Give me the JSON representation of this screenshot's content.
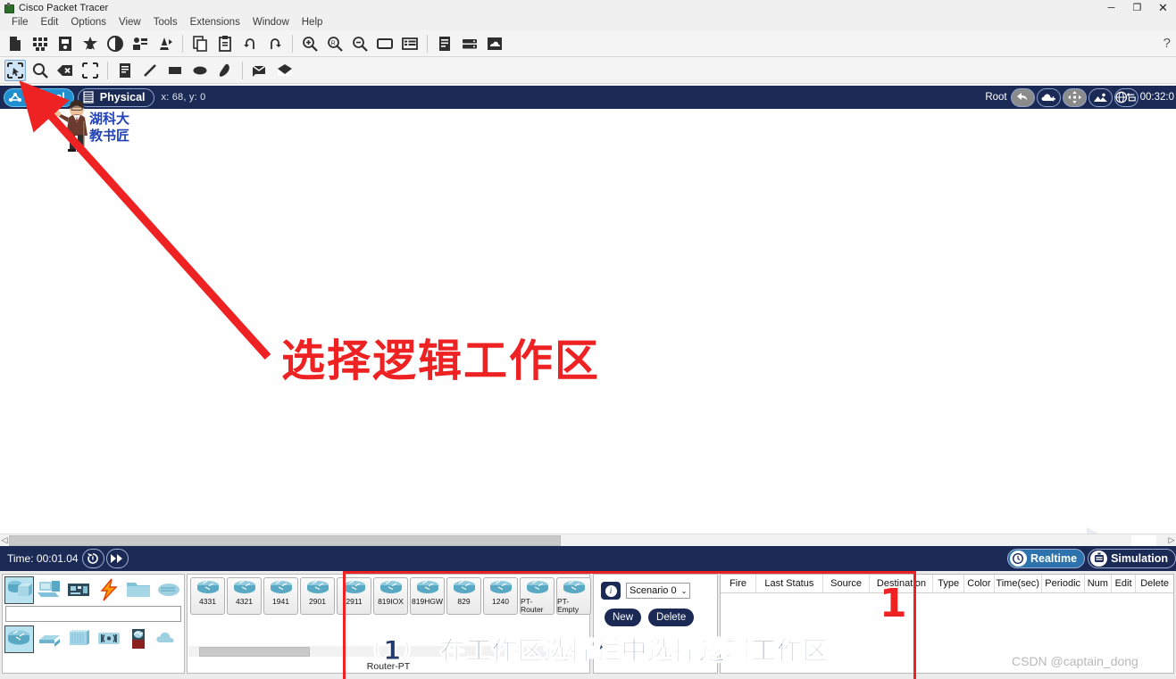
{
  "window": {
    "title": "Cisco Packet Tracer",
    "minimize": "─",
    "maximize": "❐",
    "close": "✕"
  },
  "menu": {
    "items": [
      "File",
      "Edit",
      "Options",
      "View",
      "Tools",
      "Extensions",
      "Window",
      "Help"
    ]
  },
  "toolbar_main": {
    "buttons": [
      {
        "name": "new-file",
        "icon": "document-icon"
      },
      {
        "name": "open-sample",
        "icon": "open-template-icon"
      },
      {
        "name": "open-file",
        "icon": "open-folder-icon"
      },
      {
        "name": "save-file",
        "icon": "save-icon"
      },
      {
        "name": "print",
        "icon": "print-icon"
      },
      {
        "name": "activity-wizard",
        "icon": "activity-wizard-icon"
      },
      {
        "name": "network-info",
        "icon": "network-info-icon"
      },
      {
        "name": "copy",
        "icon": "copy-icon"
      },
      {
        "name": "paste",
        "icon": "paste-icon"
      },
      {
        "name": "undo",
        "icon": "undo-icon"
      },
      {
        "name": "redo",
        "icon": "redo-icon"
      },
      {
        "name": "zoom-in",
        "icon": "zoom-in-icon"
      },
      {
        "name": "zoom-reset",
        "icon": "zoom-reset-icon"
      },
      {
        "name": "zoom-out",
        "icon": "zoom-out-icon"
      },
      {
        "name": "palette",
        "icon": "rectangle-icon"
      },
      {
        "name": "custom-devices",
        "icon": "list-icon"
      },
      {
        "name": "notes-panel",
        "icon": "notes-icon"
      },
      {
        "name": "device-template",
        "icon": "device-icon"
      },
      {
        "name": "cloud-upload",
        "icon": "cloud-icon"
      }
    ],
    "help": "?"
  },
  "toolbar_tools": {
    "buttons": [
      {
        "name": "select-tool",
        "icon": "select-icon",
        "selected": true
      },
      {
        "name": "inspect-tool",
        "icon": "magnifier-icon",
        "selected": false
      },
      {
        "name": "delete-tool",
        "icon": "delete-icon",
        "selected": false
      },
      {
        "name": "resize-shape-tool",
        "icon": "resize-icon",
        "selected": false
      },
      {
        "name": "place-note-tool",
        "icon": "note-icon",
        "selected": false
      },
      {
        "name": "draw-line-tool",
        "icon": "line-icon",
        "selected": false
      },
      {
        "name": "draw-rectangle-tool",
        "icon": "rect-icon",
        "selected": false
      },
      {
        "name": "draw-ellipse-tool",
        "icon": "ellipse-icon",
        "selected": false
      },
      {
        "name": "draw-freeform-tool",
        "icon": "freeform-icon",
        "selected": false
      },
      {
        "name": "add-simple-pdu-tool",
        "icon": "closed-envelope-icon",
        "selected": false
      },
      {
        "name": "add-complex-pdu-tool",
        "icon": "open-envelope-icon",
        "selected": false
      }
    ]
  },
  "workspace_bar": {
    "logical_tab": "Logical",
    "physical_tab": "Physical",
    "coordinates": "x: 68, y: 0",
    "root_label": "Root",
    "time": "00:32:0",
    "nav_buttons": [
      {
        "name": "back-button",
        "icon": "back-arrow-icon"
      },
      {
        "name": "new-cluster-button",
        "icon": "cloud-plus-icon"
      },
      {
        "name": "move-object-button",
        "icon": "move-arrows-icon"
      },
      {
        "name": "set-tiled-background-button",
        "icon": "image-icon"
      },
      {
        "name": "viewport-button",
        "icon": "globe-icon"
      }
    ]
  },
  "canvas": {
    "annotation_title": "选择逻辑工作区",
    "mascot_line1": "湖科大",
    "mascot_line2": "教书匠"
  },
  "time_bar": {
    "time_label": "Time: 00:01.04",
    "power_cycle": "power-cycle-icon",
    "fast_forward": "fast-forward-icon",
    "realtime_label": "Realtime",
    "simulation_label": "Simulation"
  },
  "device_categories": {
    "row1": [
      {
        "name": "network-devices",
        "icon": "router-switch-icon",
        "selected": true
      },
      {
        "name": "end-devices",
        "icon": "pc-icon",
        "selected": false
      },
      {
        "name": "components",
        "icon": "board-icon",
        "selected": false
      },
      {
        "name": "connections",
        "icon": "lightning-icon",
        "selected": false
      },
      {
        "name": "miscellaneous",
        "icon": "folder-icon",
        "selected": false
      },
      {
        "name": "multiuser-connection",
        "icon": "cloud-icon",
        "selected": false
      }
    ],
    "row2": [
      {
        "name": "routers",
        "icon": "router-icon",
        "selected": true
      },
      {
        "name": "switches",
        "icon": "switch-icon",
        "selected": false
      },
      {
        "name": "hubs",
        "icon": "hub-icon",
        "selected": false
      },
      {
        "name": "wireless-devices",
        "icon": "wireless-icon",
        "selected": false
      },
      {
        "name": "security",
        "icon": "security-icon",
        "selected": false
      },
      {
        "name": "wan-emulation",
        "icon": "wan-cloud-icon",
        "selected": false
      }
    ],
    "search_value": "",
    "search_placeholder": ""
  },
  "device_list": {
    "items": [
      "4331",
      "4321",
      "1941",
      "2901",
      "2911",
      "819IOX",
      "819HGW",
      "829",
      "1240",
      "PT-Router",
      "PT-Empty",
      "1"
    ],
    "selected_name": "Router-PT"
  },
  "scenario_panel": {
    "info_icon": "i",
    "scenario_value": "Scenario 0",
    "chevron": "⌄",
    "new_button": "New",
    "delete_button": "Delete",
    "toggle_pdu_list": "▶"
  },
  "event_table": {
    "headers": [
      "Fire",
      "Last Status",
      "Source",
      "Destination",
      "Type",
      "Color",
      "Time(sec)",
      "Periodic",
      "Num",
      "Edit",
      "Delete"
    ],
    "rows": []
  },
  "annotations": {
    "step_number": "1",
    "caption": "（1）　在工作区选择栏中选择逻辑工作区",
    "watermark": "CSDN @captain_dong",
    "accent_red": "#ee2222",
    "accent_blue": "#1b2a55"
  }
}
